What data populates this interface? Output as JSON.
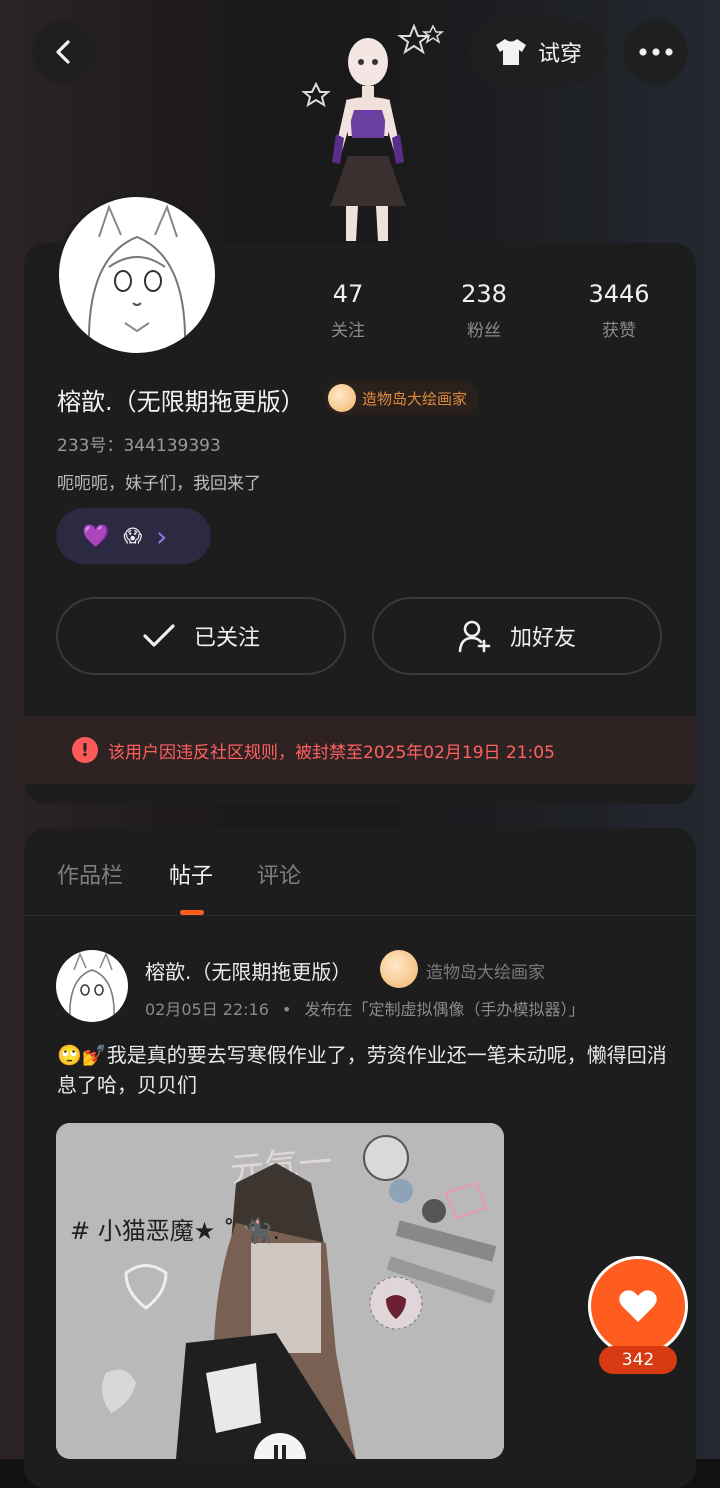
{
  "header": {
    "back_icon": "chevron-left-icon",
    "tryon_label": "试穿",
    "tryon_icon": "tshirt-icon",
    "more_icon": "more-horizontal-icon"
  },
  "profile": {
    "stats": [
      {
        "value": "47",
        "label": "关注"
      },
      {
        "value": "238",
        "label": "粉丝"
      },
      {
        "value": "3446",
        "label": "获赞"
      }
    ],
    "name": "榕歆.（无限期拖更版）",
    "badge_label": "造物岛大绘画家",
    "uid": "233号：344139393",
    "bio": "呃呃呃，妹子们，我回来了",
    "emoji_pill": {
      "emoji1": "💜",
      "emoji2": "😱",
      "chevron": "›"
    },
    "follow_button": "已关注",
    "add_friend_button": "加好友",
    "ban_notice": "该用户因违反社区规则，被封禁至2025年02月19日 21:05"
  },
  "tabs": [
    {
      "label": "作品栏",
      "active": false
    },
    {
      "label": "帖子",
      "active": true
    },
    {
      "label": "评论",
      "active": false
    }
  ],
  "post": {
    "author": "榕歆.（无限期拖更版）",
    "badge": "造物岛大绘画家",
    "date": "02月05日 22:16",
    "separator": "•",
    "published_in": "发布在「定制虚拟偶像（手办模拟器）」",
    "text": "🙄💅我是真的要去写寒假作业了，劳资作业还一笔未动呢，懒得回消息了哈，贝贝们",
    "image_caption": "# 小猫恶魔★ ˚ 🐈‍⬛."
  },
  "like": {
    "count": "342",
    "icon": "heart-icon"
  },
  "colors": {
    "accent": "#ff5d1f",
    "ban_text": "#ff6161",
    "badge_text": "#e08a3c",
    "tab_indicator": "#ff5d1f"
  }
}
